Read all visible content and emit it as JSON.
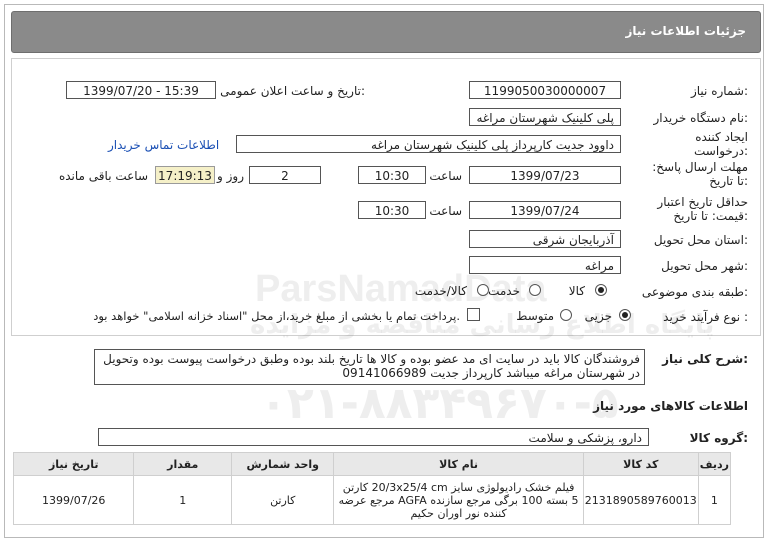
{
  "header": {
    "title": "جزئیات اطلاعات نیاز"
  },
  "labels": {
    "need_number": "شماره نیاز:",
    "announce_datetime": "تاریخ و ساعت اعلان عمومی:",
    "buyer_org": "نام دستگاه خریدار:",
    "creator": "ایجاد کننده درخواست:",
    "reply_deadline": "مهلت ارسال پاسخ: تا تاریخ:",
    "time": "ساعت",
    "day_and": "روز و",
    "remaining": "ساعت باقی مانده",
    "price_validity": "حداقل تاریخ اعتبار قیمت: تا تاریخ:",
    "delivery_province": "استان محل تحویل:",
    "delivery_city": "شهر محل تحویل:",
    "category": "طبقه بندی موضوعی:",
    "purchase_type": "نوع فرآیند خرید :",
    "description": "شرح کلی نیاز:",
    "goods_info": "اطلاعات کالاهای مورد نیاز",
    "goods_group": "گروه کالا:"
  },
  "fields": {
    "need_number": "1199050030000007",
    "announce_datetime": "1399/07/20 - 15:39",
    "buyer_org": "پلی کلینیک شهرستان مراغه",
    "creator": "داوود جدیت کارپرداز پلی کلینیک شهرستان مراغه",
    "contact_link": "اطلاعات تماس خریدار",
    "reply_date": "1399/07/23",
    "reply_time": "10:30",
    "reply_days": "2",
    "remaining_time": "17:19:13",
    "validity_date": "1399/07/24",
    "validity_time": "10:30",
    "province": "آذربایجان شرقی",
    "city": "مراغه",
    "goods_group": "دارو، پزشکی و سلامت"
  },
  "category_options": [
    {
      "label": "کالا",
      "selected": true
    },
    {
      "label": "خدمت",
      "selected": false
    },
    {
      "label": "کالا/خدمت",
      "selected": false
    }
  ],
  "purchase_options": [
    {
      "label": "جزیی",
      "selected": true
    },
    {
      "label": "متوسط",
      "selected": false
    }
  ],
  "payment_note": "پرداخت تمام یا بخشی از مبلغ خرید،از محل \"اسناد خزانه اسلامی\" خواهد بود.",
  "description_text": "فروشندگان کالا باید در سایت ای مد عضو بوده و کالا ها تاریخ بلند بوده وطبق درخواست پیوست بوده وتحویل در شهرستان مراغه میباشد کارپرداز جدیت 09141066989",
  "table": {
    "headers": [
      "ردیف",
      "کد کالا",
      "نام کالا",
      "واحد شمارش",
      "مقدار",
      "تاریخ نیاز"
    ],
    "rows": [
      {
        "row": "1",
        "code": "2131890589760013",
        "name": "فیلم خشک رادیولوژی سایز 20/3x25/4 cm کارتن 5 بسته 100 برگی مرجع سازنده AGFA مرجع عرضه کننده نور اوران حکیم",
        "unit": "کارتن",
        "qty": "1",
        "date": "1399/07/26"
      }
    ]
  },
  "watermark": {
    "line1": "ParsNamadData",
    "line2": "پایگاه اطلاع رسانی مناقصه و مزایده",
    "line3": "۰۲۱-۸۸۳۴۹۶۷۰-۵"
  }
}
